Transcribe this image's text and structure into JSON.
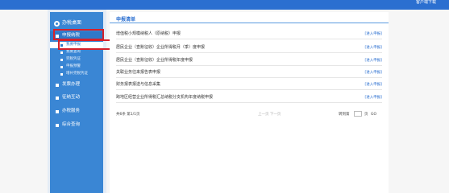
{
  "topbar": {
    "client_download": "客户端下载",
    "color": "#2b6fd0"
  },
  "sidebar": {
    "header": "办税桌面",
    "menus": [
      {
        "label": "申报纳税",
        "active": true
      },
      {
        "label": "发票办理"
      },
      {
        "label": "征纳互动"
      },
      {
        "label": "办税服务"
      },
      {
        "label": "综合查询"
      }
    ],
    "submenus": [
      {
        "label": "我要申报",
        "active": true
      },
      {
        "label": "我要查询"
      },
      {
        "label": "完税凭证"
      },
      {
        "label": "申报预警"
      },
      {
        "label": "增补完税凭证"
      }
    ]
  },
  "content": {
    "title": "申报清单",
    "rows": [
      {
        "name": "增值税小规模纳税人（原纳税）申报",
        "action": "[进入申报]"
      },
      {
        "name": "居民企业（查账征收）企业所得税月（季）度申报",
        "action": "[进入申报]"
      },
      {
        "name": "居民企业（查账征收）企业所得税年度申报",
        "action": "[进入申报]"
      },
      {
        "name": "关联业务往来报告表申报",
        "action": "[进入申报]"
      },
      {
        "name": "财务报表报送与信息采集",
        "action": "[进入申报]"
      },
      {
        "name": "跨地区经营企业所得税汇总纳税分支机构年度纳税申报",
        "action": "[进入申报]"
      }
    ],
    "footer": {
      "summary": "共6条 第1/1页",
      "pager": "上一页 下一页",
      "goto_label": "转到第",
      "page_suffix": "页",
      "go_label": "GO"
    }
  },
  "colors": {
    "accent": "#2b6fd0",
    "sidebar": "#3a86d4",
    "highlight": "#d6202a"
  }
}
